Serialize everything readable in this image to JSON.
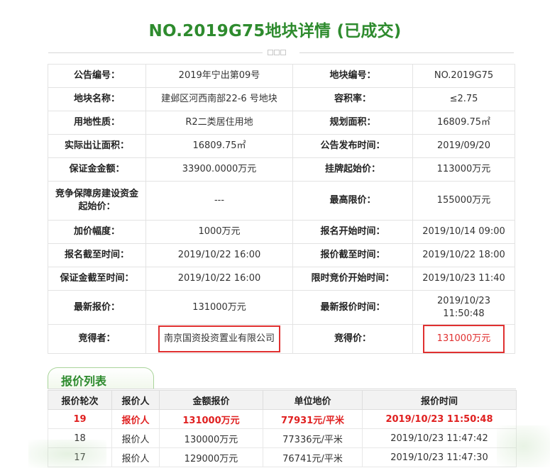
{
  "title": "NO.2019G75地块详情 (已成交)",
  "detail": {
    "r1": {
      "l1": "公告编号：",
      "v1": "2019年宁出第09号",
      "l2": "地块编号：",
      "v2": "NO.2019G75"
    },
    "r2": {
      "l1": "地块名称：",
      "v1": "建邺区河西南部22-6 号地块",
      "l2": "容积率：",
      "v2": "≤2.75"
    },
    "r3": {
      "l1": "用地性质：",
      "v1": "R2二类居住用地",
      "l2": "规划面积：",
      "v2": "16809.75㎡"
    },
    "r4": {
      "l1": "实际出让面积：",
      "v1": "16809.75㎡",
      "l2": "公告发布时间：",
      "v2": "2019/09/20"
    },
    "r5": {
      "l1": "保证金金额：",
      "v1": "33900.0000万元",
      "l2": "挂牌起始价：",
      "v2": "113000万元"
    },
    "r6": {
      "l1": "竞争保障房建设资金起始价：",
      "v1": "---",
      "l2": "最高限价：",
      "v2": "155000万元"
    },
    "r7": {
      "l1": "加价幅度：",
      "v1": "1000万元",
      "l2": "报名开始时间：",
      "v2": "2019/10/14 09:00"
    },
    "r8": {
      "l1": "报名截至时间：",
      "v1": "2019/10/22 16:00",
      "l2": "报价截至时间：",
      "v2": "2019/10/22 18:00"
    },
    "r9": {
      "l1": "保证金截至时间：",
      "v1": "2019/10/22 16:00",
      "l2": "限时竞价开始时间：",
      "v2": "2019/10/23 11:40"
    },
    "r10": {
      "l1": "最新报价：",
      "v1": "131000万元",
      "l2": "最新报价时间：",
      "v2": "2019/10/23 11:50:48"
    },
    "r11": {
      "l1": "竞得者：",
      "v1": "南京国资投资置业有限公司",
      "l2": "竞得价：",
      "v2": "131000万元"
    }
  },
  "bid_tab": "报价列表",
  "bids": {
    "headers": [
      "报价轮次",
      "报价人",
      "金额报价",
      "单位地价",
      "报价时间"
    ],
    "rows": [
      [
        "19",
        "报价人",
        "131000万元",
        "77931元/平米",
        "2019/10/23 11:50:48"
      ],
      [
        "18",
        "报价人",
        "130000万元",
        "77336元/平米",
        "2019/10/23 11:47:42"
      ],
      [
        "17",
        "报价人",
        "129000万元",
        "76741元/平米",
        "2019/10/23 11:47:30"
      ]
    ]
  },
  "colors": {
    "accent_green": "#2e8b2e",
    "highlight_red": "#e02020"
  }
}
